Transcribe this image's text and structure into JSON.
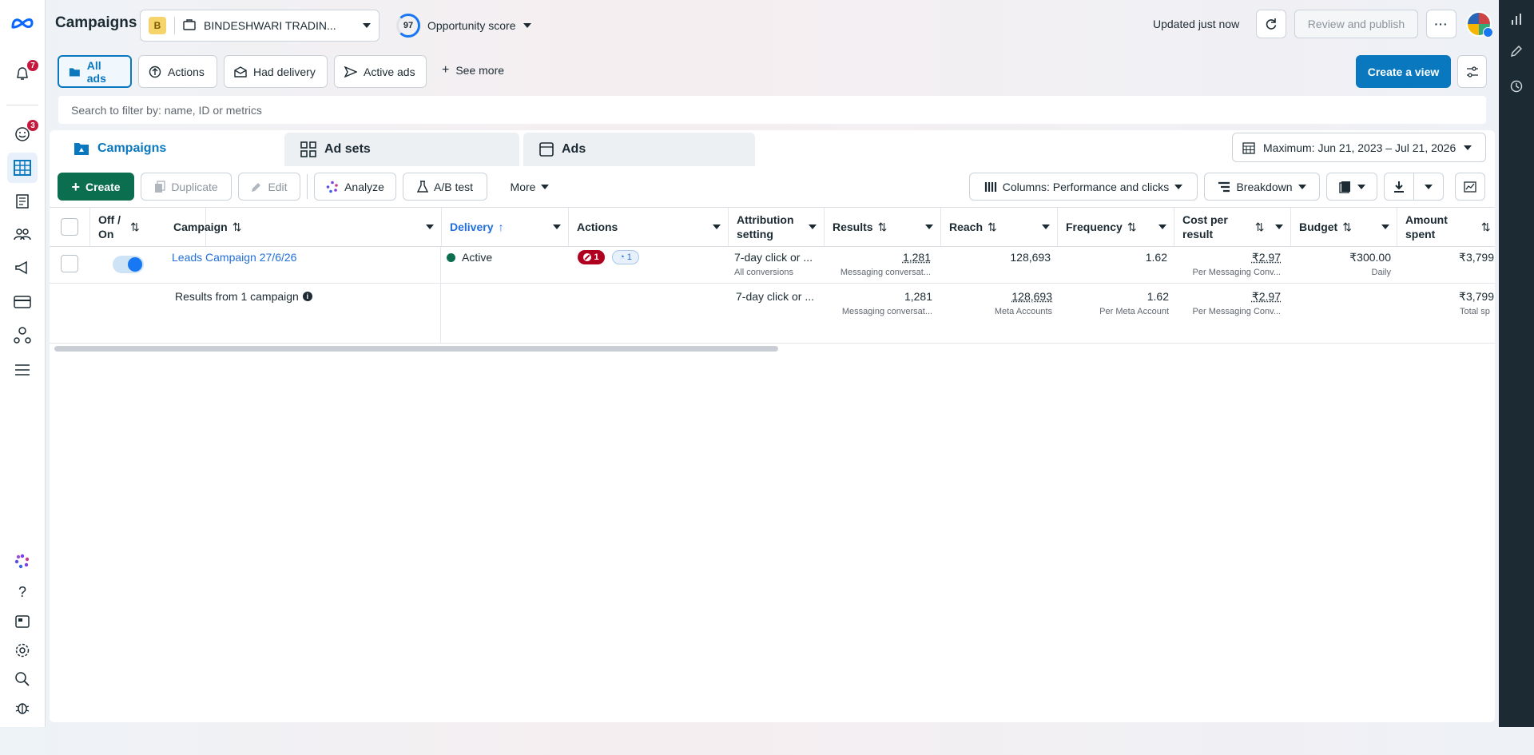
{
  "header": {
    "title": "Campaigns",
    "account_initial": "B",
    "account_name": "BINDESHWARI TRADIN...",
    "opportunity_value": "97",
    "opportunity_label": "Opportunity score",
    "updated": "Updated just now",
    "review_publish": "Review and publish"
  },
  "left_rail": {
    "notifications_count": "7",
    "smiley_count": "3"
  },
  "views": {
    "all_ads": "All ads",
    "actions": "Actions",
    "had_delivery": "Had delivery",
    "active_ads": "Active ads",
    "see_more": "See more",
    "create_view": "Create a view"
  },
  "search": {
    "placeholder": "Search to filter by: name, ID or metrics"
  },
  "tabs": {
    "campaigns": "Campaigns",
    "ad_sets": "Ad sets",
    "ads": "Ads"
  },
  "date_range": "Maximum: Jun 21, 2023 – Jul 21, 2026",
  "toolbar": {
    "create": "Create",
    "duplicate": "Duplicate",
    "edit": "Edit",
    "analyze": "Analyze",
    "ab_test": "A/B test",
    "more": "More",
    "columns": "Columns: Performance and clicks",
    "breakdown": "Breakdown"
  },
  "table": {
    "headers": {
      "off_on_1": "Off /",
      "off_on_2": "On",
      "campaign": "Campaign",
      "delivery": "Delivery",
      "actions": "Actions",
      "attribution_1": "Attribution",
      "attribution_2": "setting",
      "results": "Results",
      "reach": "Reach",
      "frequency": "Frequency",
      "cost_1": "Cost per",
      "cost_2": "result",
      "budget": "Budget",
      "amount_1": "Amount",
      "amount_2": "spent"
    },
    "row": {
      "campaign_name": "Leads Campaign 27/6/26",
      "delivery": "Active",
      "actions_red": "1",
      "actions_blue": "1",
      "attribution": "7-day click or ...",
      "attribution_sub": "All conversions",
      "results": "1,281",
      "results_sub": "Messaging conversat...",
      "reach": "128,693",
      "frequency": "1.62",
      "cost": "₹2.97",
      "cost_sub": "Per Messaging Conv...",
      "budget": "₹300.00",
      "budget_sub": "Daily",
      "amount": "₹3,799"
    },
    "summary": {
      "label": "Results from 1 campaign",
      "attribution": "7-day click or ...",
      "results": "1,281",
      "results_sub": "Messaging conversat...",
      "reach": "128,693",
      "reach_sub": "Meta Accounts",
      "frequency": "1.62",
      "frequency_sub": "Per Meta Account",
      "cost": "₹2.97",
      "cost_sub": "Per Messaging Conv...",
      "amount": "₹3,799",
      "amount_sub": "Total sp"
    }
  },
  "colors": {
    "accent": "#0a78be",
    "create": "#0b6e4f",
    "badge": "#c4183c"
  }
}
